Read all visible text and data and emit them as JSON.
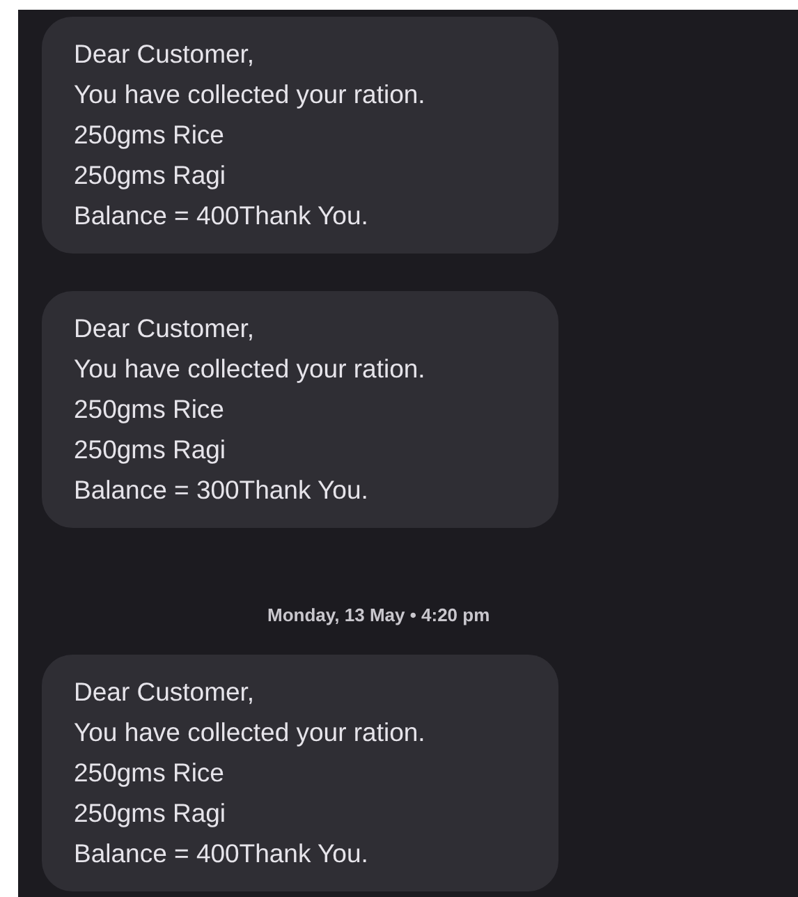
{
  "conversation": [
    {
      "kind": "message",
      "text": "Dear Customer,\nYou have collected your ration.\n250gms Rice\n250gms Ragi\nBalance = 400Thank You."
    },
    {
      "kind": "message",
      "text": "Dear Customer,\nYou have collected your ration.\n250gms Rice\n250gms Ragi\nBalance = 300Thank You."
    },
    {
      "kind": "timestamp",
      "text": "Monday, 13 May • 4:20 pm"
    },
    {
      "kind": "message",
      "text": "Dear Customer,\nYou have collected your ration.\n250gms Rice\n250gms Ragi\nBalance = 400Thank You."
    }
  ]
}
